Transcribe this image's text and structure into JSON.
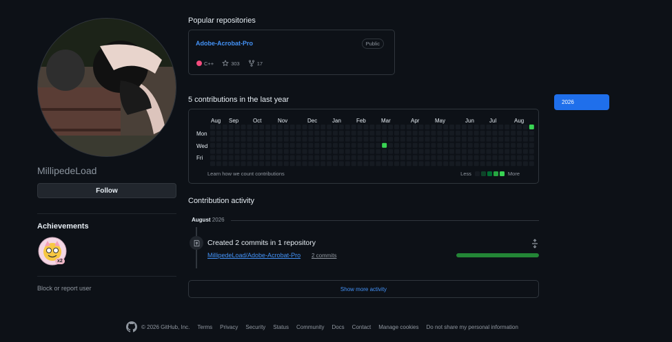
{
  "profile": {
    "username": "MillipedeLoad",
    "follow_label": "Follow",
    "achievements_title": "Achievements",
    "achievement_multiplier": "x2",
    "block_label": "Block or report user"
  },
  "popular": {
    "title": "Popular repositories",
    "repo": {
      "name": "Adobe-Acrobat-Pro",
      "visibility": "Public",
      "language": "C++",
      "language_color": "#f34b7d",
      "stars": "303",
      "forks": "17"
    }
  },
  "contributions": {
    "title": "5 contributions in the last year",
    "months": [
      "Aug",
      "Sep",
      "Oct",
      "Nov",
      "Dec",
      "Jan",
      "Feb",
      "Mar",
      "Apr",
      "May",
      "Jun",
      "Jul",
      "Aug"
    ],
    "days": [
      "Mon",
      "Wed",
      "Fri"
    ],
    "learn_label": "Learn how we count contributions",
    "legend_less": "Less",
    "legend_more": "More",
    "level_colors": [
      "#161b22",
      "#0e4429",
      "#006d32",
      "#26a641",
      "#39d353"
    ],
    "active_cells": [
      {
        "week": 28,
        "day": 3,
        "level": 4
      },
      {
        "week": 52,
        "day": 0,
        "level": 4
      }
    ]
  },
  "year_selector": {
    "selected": "2026"
  },
  "activity": {
    "title": "Contribution activity",
    "month": "August",
    "year": "2026",
    "commit_title": "Created 2 commits in 1 repository",
    "repo_link": "MillipedeLoad/Adobe-Acrobat-Pro",
    "commit_count": "2 commits",
    "progress_percent": 100,
    "show_more": "Show more activity"
  },
  "footer": {
    "copyright": "© 2026 GitHub, Inc.",
    "links": [
      "Terms",
      "Privacy",
      "Security",
      "Status",
      "Community",
      "Docs",
      "Contact",
      "Manage cookies",
      "Do not share my personal information"
    ]
  },
  "colors": {
    "accent": "#4493f8",
    "primary_button": "#1f6feb",
    "background": "#0d1117"
  }
}
